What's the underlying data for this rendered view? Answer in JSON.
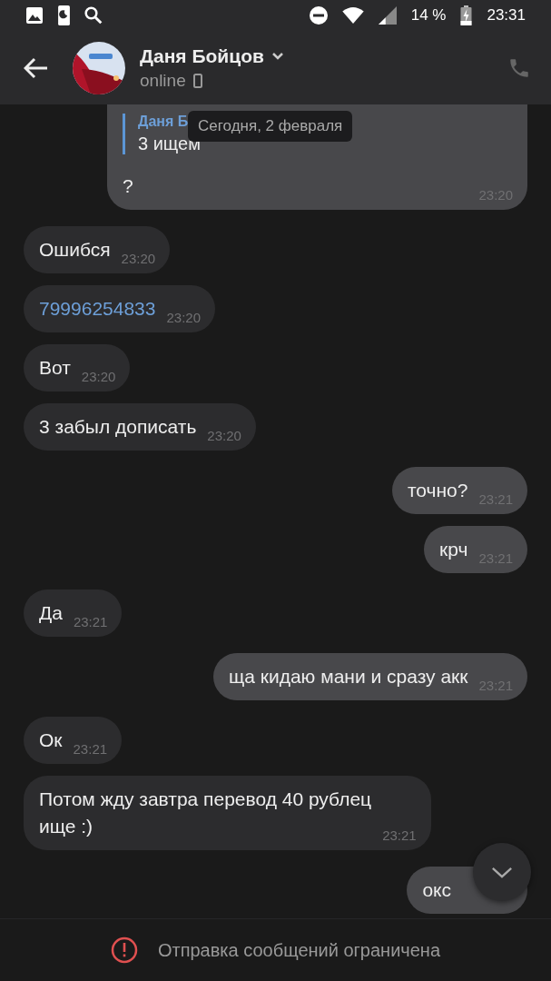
{
  "status_bar": {
    "percent": "14 %",
    "time": "23:31"
  },
  "header": {
    "name": "Даня Бойцов",
    "status": "online"
  },
  "date_badge": "Сегодня, 2 февраля",
  "messages": [
    {
      "outgoing": true,
      "reply_author": "Даня Б",
      "reply_text": "3 ищем",
      "kind": "text",
      "text": "?",
      "time": "23:20"
    },
    {
      "outgoing": false,
      "kind": "text",
      "text": "Ошибся",
      "time": "23:20"
    },
    {
      "outgoing": false,
      "kind": "link",
      "text": "79996254833",
      "time": "23:20"
    },
    {
      "outgoing": false,
      "kind": "text",
      "text": "Вот",
      "time": "23:20"
    },
    {
      "outgoing": false,
      "kind": "text",
      "text": "3 забыл дописать",
      "time": "23:20"
    },
    {
      "outgoing": true,
      "kind": "text",
      "text": "точно?",
      "time": "23:21"
    },
    {
      "outgoing": true,
      "kind": "text",
      "text": "крч",
      "time": "23:21"
    },
    {
      "outgoing": false,
      "kind": "text",
      "text": "Да",
      "time": "23:21"
    },
    {
      "outgoing": true,
      "kind": "text",
      "text": "ща кидаю мани и сразу акк",
      "time": "23:21"
    },
    {
      "outgoing": false,
      "kind": "text",
      "text": "Ок",
      "time": "23:21"
    },
    {
      "outgoing": false,
      "kind": "text",
      "text": "Потом жду завтра перевод 40 рублец\nище :)",
      "time": "23:21"
    },
    {
      "outgoing": true,
      "kind": "text",
      "text": "окс"
    }
  ],
  "footer": {
    "notice": "Отправка сообщений ограничена"
  }
}
